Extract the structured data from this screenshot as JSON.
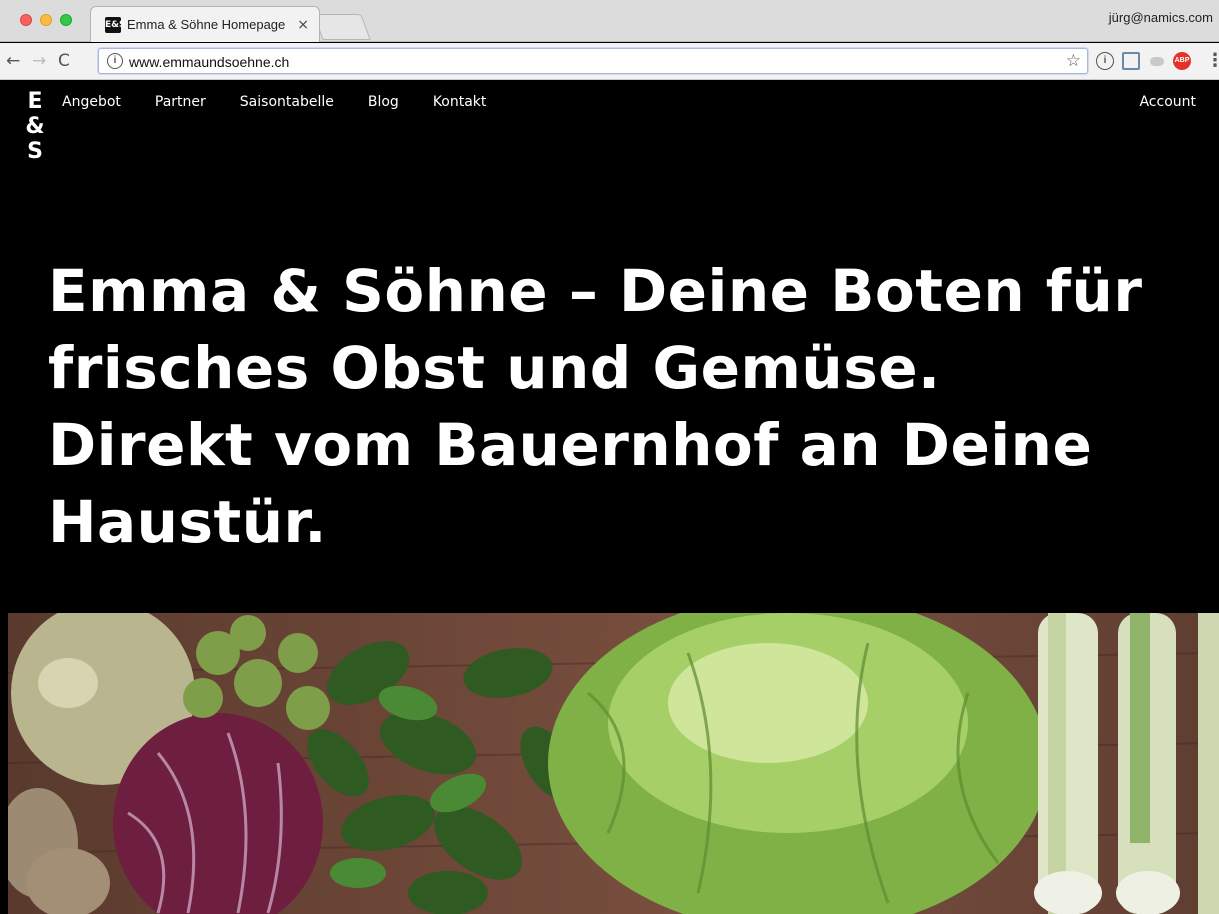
{
  "browser": {
    "tab_title": "Emma & Söhne Homepage",
    "tab_favicon": "E&S",
    "tab_close": "×",
    "profile": "jürg@namics.com",
    "url": "www.emmaundsoehne.ch",
    "back": "←",
    "forward": "→",
    "reload": "C",
    "star": "☆",
    "info": "i",
    "ext_onepassword": "i",
    "ext_adblock": "ABP",
    "menu": "⋮"
  },
  "site": {
    "logo": [
      "E",
      "&",
      "S"
    ],
    "nav": [
      "Angebot",
      "Partner",
      "Saisontabelle",
      "Blog",
      "Kontakt"
    ],
    "account": "Account",
    "hero_lines": [
      "Emma & Söhne – Deine Boten für",
      "frisches Obst und Gemüse.",
      "Direkt vom Bauernhof an Deine",
      "Haustür."
    ]
  },
  "colors": {
    "page_bg": "#000000",
    "text": "#ffffff",
    "lettuce": "#8fc24f",
    "cabbage": "#6e1f3f",
    "wood": "#6a4536"
  }
}
